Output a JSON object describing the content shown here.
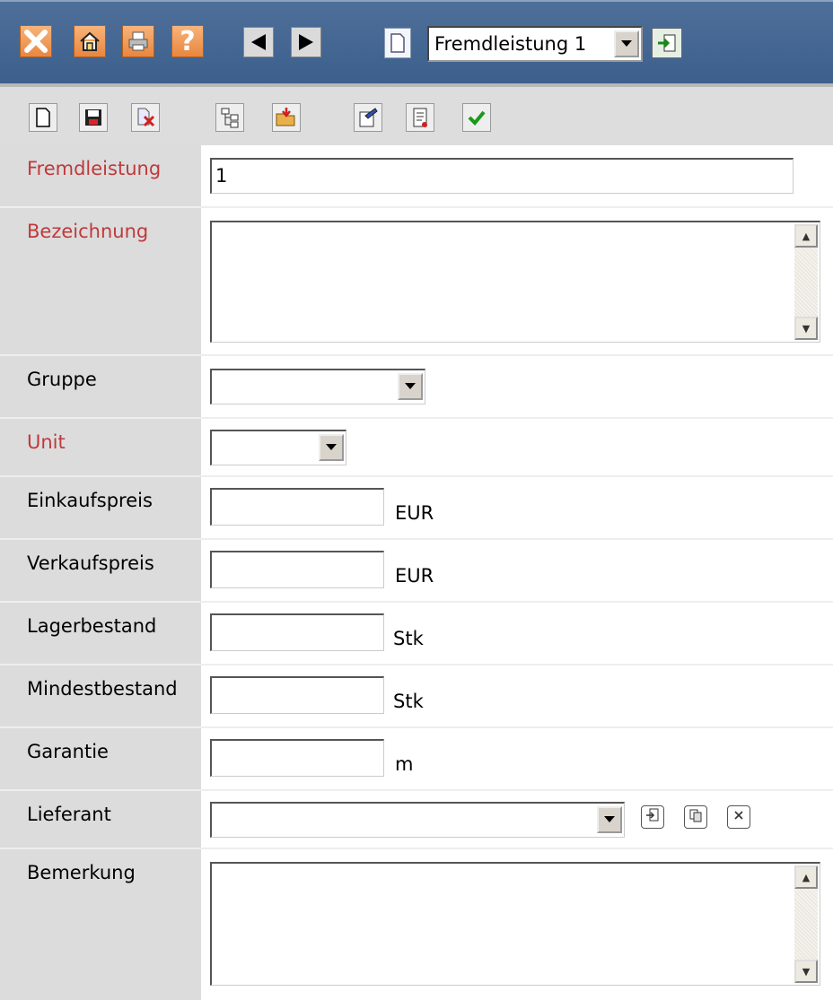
{
  "topbar": {
    "close_icon": "close-icon",
    "home_icon": "home-icon",
    "print_icon": "print-icon",
    "help_label": "?",
    "record_select_value": "Fremdleistung 1"
  },
  "toolbar2": {
    "icons": [
      "new-document-icon",
      "save-icon",
      "delete-icon",
      "tree-icon",
      "open-folder-icon",
      "properties-icon",
      "report-icon",
      "confirm-check-icon"
    ]
  },
  "form": {
    "fremdleistung": {
      "label": "Fremdleistung",
      "value": "1"
    },
    "bezeichnung": {
      "label": "Bezeichnung",
      "value": ""
    },
    "gruppe": {
      "label": "Gruppe",
      "value": ""
    },
    "unit": {
      "label": "Unit",
      "value": ""
    },
    "einkaufspreis": {
      "label": "Einkaufspreis",
      "value": "",
      "unit": "EUR"
    },
    "verkaufspreis": {
      "label": "Verkaufspreis",
      "value": "",
      "unit": "EUR"
    },
    "lagerbestand": {
      "label": "Lagerbestand",
      "value": "",
      "unit": "Stk"
    },
    "mindestbestand": {
      "label": "Mindestbestand",
      "value": "",
      "unit": "Stk"
    },
    "garantie": {
      "label": "Garantie",
      "value": "",
      "unit": "m"
    },
    "lieferant": {
      "label": "Lieferant",
      "value": ""
    },
    "bemerkung": {
      "label": "Bemerkung",
      "value": ""
    }
  },
  "colors": {
    "topbar": "#45678f",
    "required_label": "#c0393b",
    "label_bg": "#dcdcdc",
    "toolbar_bg": "#dddddd"
  }
}
